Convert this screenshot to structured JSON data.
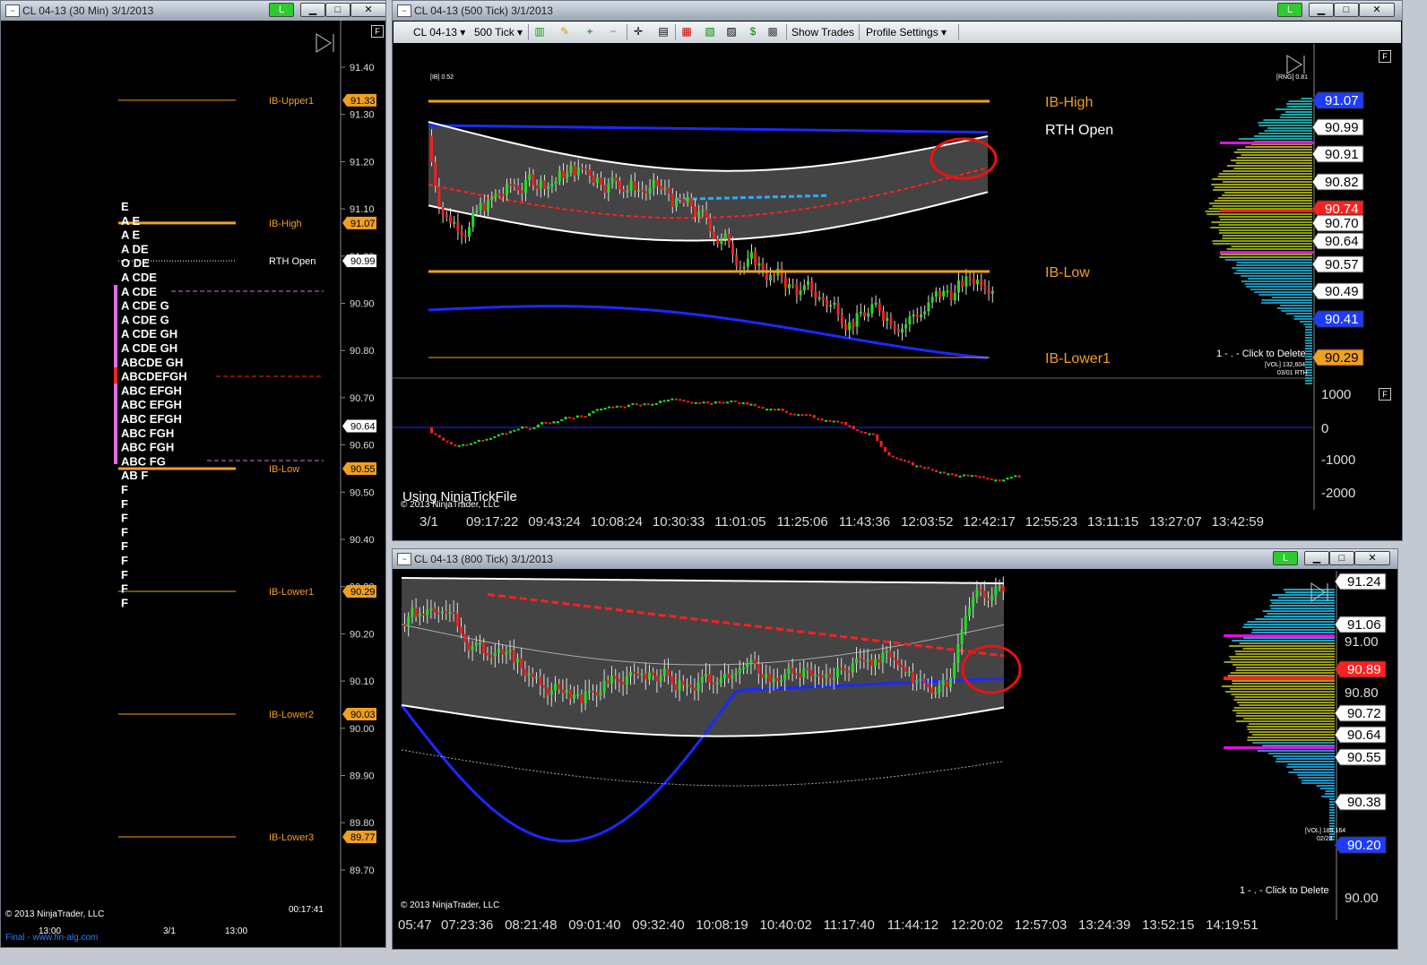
{
  "windows": {
    "left": {
      "title": "CL 04-13 (30 Min)  3/1/2013",
      "link_label": "L",
      "panel_label": "F",
      "copyright": "© 2013 NinjaTrader, LLC",
      "timer": "00:17:41",
      "footer_link": "Final - www.fin-alg.com",
      "x_ticks": [
        "13:00",
        "3/1",
        "13:00"
      ]
    },
    "tick500": {
      "title": "CL 04-13 (500 Tick)  3/1/2013",
      "link_label": "L",
      "instrument": "CL 04-13",
      "interval": "500 Tick",
      "show_trades": "Show Trades",
      "profile_settings": "Profile Settings",
      "panel_label": "F",
      "indicator_panel_label": "F",
      "ib_small": "[IB] 0.52",
      "rng_small": "[RNG] 0.81",
      "vol_small": "[VOL] 132,604",
      "vol_date_small": "03/01 RTH",
      "click_to_delete": "1 - . - Click to Delete",
      "using_file": "Using NinjaTickFile",
      "copyright": "© 2013 NinjaTrader, LLC",
      "x_ticks": [
        "3/1",
        "09:17:22",
        "09:43:24",
        "10:08:24",
        "10:30:33",
        "11:01:05",
        "11:25:06",
        "11:43:36",
        "12:03:52",
        "12:42:17",
        "12:55:23",
        "13:11:15",
        "13:27:07",
        "13:42:59"
      ],
      "indicator_ticks": [
        "1000",
        "0",
        "-1000",
        "-2000"
      ]
    },
    "tick800": {
      "title": "CL 04-13 (800 Tick)  3/1/2013",
      "link_label": "L",
      "vol_small": "[VOL] 185,164",
      "vol_date_small": "02/28",
      "click_to_delete": "1 - . - Click to Delete",
      "copyright": "© 2013 NinjaTrader, LLC",
      "x_ticks": [
        "05:47",
        "07:23:36",
        "08:21:48",
        "09:01:40",
        "09:32:40",
        "10:08:19",
        "10:40:02",
        "11:17:40",
        "11:44:12",
        "12:20:02",
        "12:57:03",
        "13:24:39",
        "13:52:15",
        "14:19:51"
      ],
      "axis_ticks": [
        "91.00",
        "90.80",
        "90.00"
      ]
    }
  },
  "chart_data": [
    {
      "type": "market-profile",
      "axis_ticks": [
        "91.40",
        "91.30",
        "91.20",
        "91.10",
        "91.00",
        "90.90",
        "90.80",
        "90.70",
        "90.60",
        "90.50",
        "90.40",
        "90.30",
        "90.20",
        "90.10",
        "90.00",
        "89.90",
        "89.80",
        "89.70"
      ],
      "levels": [
        {
          "name": "IB-Upper1",
          "price": 91.33,
          "label": "91.33",
          "color": "#f0a020"
        },
        {
          "name": "IB-High",
          "price": 91.07,
          "label": "91.07",
          "color": "#f0a020"
        },
        {
          "name": "RTH Open",
          "price": 90.99,
          "label": "90.99",
          "color": "#ffffff"
        },
        {
          "name": "IB-Low",
          "price": 90.55,
          "label": "90.55",
          "color": "#f0a020"
        },
        {
          "name": "IB-Lower1",
          "price": 90.29,
          "label": "90.29",
          "color": "#f0a020"
        },
        {
          "name": "IB-Lower2",
          "price": 90.03,
          "label": "90.03",
          "color": "#f0a020"
        },
        {
          "name": "IB-Lower3",
          "price": 89.77,
          "label": "89.77",
          "color": "#f0a020"
        }
      ],
      "last_price": "90.64",
      "tpo_rows": [
        "       E",
        "A      E",
        "A      E",
        "A    DE",
        "O    DE",
        "A  CDE",
        "A  CDE",
        "A  CDE  G",
        "A  CDE  G",
        "A  CDE  GH",
        "A  CDE  GH",
        "ABCDE  GH",
        "ABCDEFGH",
        "ABC  EFGH",
        "ABC  EFGH",
        "ABC  EFGH",
        "ABC    FGH",
        "ABC    FGH",
        "ABC    FG",
        "AB     F",
        "       F",
        "       F",
        "       F",
        "       F",
        "       F",
        "       F",
        "       F",
        "       F",
        "       F"
      ]
    },
    {
      "type": "candlestick",
      "interval": "500 Tick",
      "ylim": [
        90.25,
        91.15
      ],
      "levels": [
        {
          "name": "IB-High",
          "color": "#f0a020"
        },
        {
          "name": "RTH Open",
          "color": "#ffffff"
        },
        {
          "name": "IB-Low",
          "color": "#f0a020"
        },
        {
          "name": "IB-Lower1",
          "color": "#f0a020"
        }
      ],
      "price_tags": [
        {
          "label": "91.07",
          "color": "#1e3cff"
        },
        {
          "label": "90.99",
          "color": "#ffffff"
        },
        {
          "label": "90.91",
          "color": "#ffffff"
        },
        {
          "label": "90.82",
          "color": "#ffffff"
        },
        {
          "label": "90.74",
          "color": "#ff2020"
        },
        {
          "label": "90.70",
          "color": "#ffffff"
        },
        {
          "label": "90.64",
          "color": "#ffffff"
        },
        {
          "label": "90.57",
          "color": "#ffffff"
        },
        {
          "label": "90.49",
          "color": "#ffffff"
        },
        {
          "label": "90.41",
          "color": "#1e3cff"
        },
        {
          "label": "90.29",
          "color": "#f0a020"
        }
      ]
    },
    {
      "type": "candlestick",
      "interval": "800 Tick",
      "price_tags": [
        {
          "label": "91.24",
          "color": "#ffffff"
        },
        {
          "label": "91.06",
          "color": "#ffffff"
        },
        {
          "label": "90.89",
          "color": "#ff2020"
        },
        {
          "label": "90.72",
          "color": "#ffffff"
        },
        {
          "label": "90.64",
          "color": "#ffffff"
        },
        {
          "label": "90.55",
          "color": "#ffffff"
        },
        {
          "label": "90.38",
          "color": "#ffffff"
        },
        {
          "label": "90.20",
          "color": "#1e3cff"
        }
      ]
    }
  ],
  "colors": {
    "up_candle": "#22dd22",
    "down_candle": "#ee2222",
    "ib_line": "#f0a020",
    "band_outer": "#1a2aff",
    "vwap": "#ff2020",
    "midline": "#20b0ff",
    "highlight_circle": "#ee1111"
  }
}
